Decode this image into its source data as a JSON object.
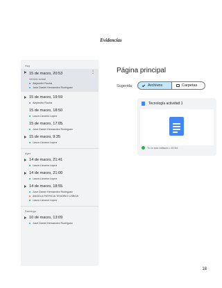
{
  "document": {
    "title": "Evidencias",
    "page_number": "18"
  },
  "history": {
    "groups": [
      {
        "label": "Hoy",
        "versions": [
          {
            "date": "15 de marzo, 20:53",
            "subtitle": "Versión actual",
            "selected": true,
            "authors": [
              {
                "name": "Alejandro Rocha",
                "color": "#7b5fc4"
              },
              {
                "name": "Jose Daniel Hernandez Rodriguez",
                "color": "#12b5cb"
              }
            ]
          },
          {
            "date": "15 de marzo, 19:59",
            "authors": [
              {
                "name": "Alejandro Rocha",
                "color": "#7b5fc4"
              }
            ]
          },
          {
            "date": "15 de marzo, 18:50",
            "authors": [
              {
                "name": "Laura Lizcano Lopez",
                "color": "#1a9fa8"
              }
            ]
          },
          {
            "date": "15 de marzo, 17:05",
            "authors": [
              {
                "name": "Jose Daniel Hernandez Rodriguez",
                "color": "#12b5cb"
              }
            ]
          },
          {
            "date": "15 de marzo, 9:35",
            "authors": [
              {
                "name": "Laura Lizcano Lopez",
                "color": "#1a9fa8"
              }
            ]
          }
        ]
      },
      {
        "label": "Ayer",
        "versions": [
          {
            "date": "14 de marzo, 21:41",
            "authors": [
              {
                "name": "Laura Lizcano Lopez",
                "color": "#1a9fa8"
              }
            ]
          },
          {
            "date": "14 de marzo, 21:00",
            "authors": [
              {
                "name": "Laura Lizcano Lopez",
                "color": "#1a9fa8"
              }
            ]
          },
          {
            "date": "14 de marzo, 18:55",
            "authors": [
              {
                "name": "Jose Daniel Hernandez Rodriguez",
                "color": "#12b5cb"
              },
              {
                "name": "ANGELA PATRICIA TENORIO LISBOA",
                "color": "#e8710a"
              },
              {
                "name": "Laura Lizcano Lopez",
                "color": "#1a9fa8"
              }
            ]
          }
        ]
      },
      {
        "label": "Domingo",
        "versions": [
          {
            "date": "10 de marzo, 13:09",
            "authors": [
              {
                "name": "Jose Daniel Hernandez Rodriguez",
                "color": "#12b5cb"
              }
            ]
          }
        ]
      }
    ]
  },
  "drive": {
    "title": "Página principal",
    "suggested_label": "Sugerida",
    "chips": {
      "files": "Archivos",
      "folders": "Carpetas"
    },
    "file_card": {
      "name": "Tecnología actividad 1",
      "edited": "Tú lo has editado • 20:54",
      "icon": "google-docs-icon",
      "doc_color": "#4285f4"
    }
  }
}
